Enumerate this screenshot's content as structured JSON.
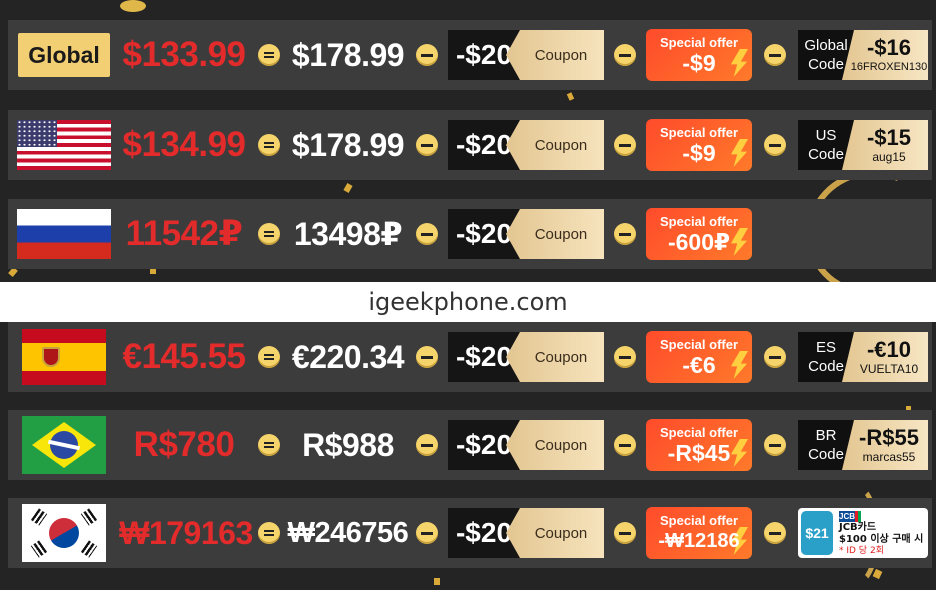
{
  "watermark": "igeekphone.com",
  "colors": {
    "price_red": "#e32b2b",
    "badge_gold": "#f2cf73",
    "row_bg": "#3c3c3c",
    "special_orange": "#ff5a2a"
  },
  "rows": [
    {
      "region": "Global",
      "flag_icon": "global-badge",
      "price": "$133.99",
      "original": "$178.99",
      "coupon_amount": "-$20",
      "coupon_label": "Coupon",
      "special_label": "Special offer",
      "special_amount": "-$9",
      "code_line1": "Global",
      "code_line2": "Code",
      "code_amount": "-$16",
      "code": "16FROXEN130"
    },
    {
      "region": "US",
      "flag_icon": "us-flag-icon",
      "price": "$134.99",
      "original": "$178.99",
      "coupon_amount": "-$20",
      "coupon_label": "Coupon",
      "special_label": "Special offer",
      "special_amount": "-$9",
      "code_line1": "US",
      "code_line2": "Code",
      "code_amount": "-$15",
      "code": "aug15"
    },
    {
      "region": "RU",
      "flag_icon": "russia-flag-icon",
      "price": "11542₽",
      "original": "13498₽",
      "coupon_amount": "-$20",
      "coupon_label": "Coupon",
      "special_label": "Special offer",
      "special_amount": "-600₽"
    },
    {
      "region": "ES",
      "flag_icon": "spain-flag-icon",
      "price": "€145.55",
      "original": "€220.34",
      "coupon_amount": "-$20",
      "coupon_label": "Coupon",
      "special_label": "Special offer",
      "special_amount": "-€6",
      "code_line1": "ES",
      "code_line2": "Code",
      "code_amount": "-€10",
      "code": "VUELTA10"
    },
    {
      "region": "BR",
      "flag_icon": "brazil-flag-icon",
      "price": "R$780",
      "original": "R$988",
      "coupon_amount": "-$20",
      "coupon_label": "Coupon",
      "special_label": "Special offer",
      "special_amount": "-R$45",
      "code_line1": "BR",
      "code_line2": "Code",
      "code_amount": "-R$55",
      "code": "marcas55"
    },
    {
      "region": "KR",
      "flag_icon": "korea-flag-icon",
      "price": "₩179163",
      "original": "₩246756",
      "coupon_amount": "-$20",
      "coupon_label": "Coupon",
      "special_label": "Special offer",
      "special_amount": "-₩12186",
      "jcb_amount": "$21",
      "jcb_logo": "JCB",
      "jcb_line1": "JCB카드",
      "jcb_line2": "$100 이상 구매 시",
      "jcb_line3": "* ID 당 2회"
    }
  ]
}
